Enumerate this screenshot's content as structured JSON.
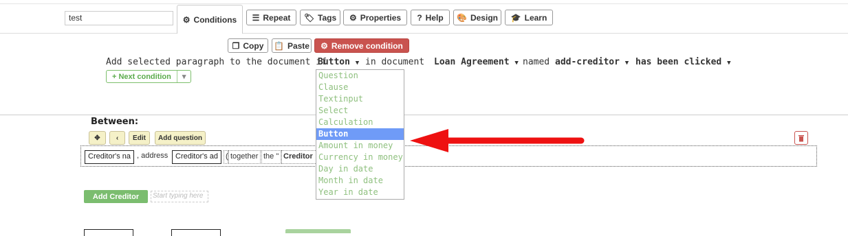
{
  "title_input_value": "test",
  "tabs": [
    {
      "label": "Conditions",
      "icon": "cogs-icon"
    },
    {
      "label": "Repeat",
      "icon": "list-ordered-icon"
    },
    {
      "label": "Tags",
      "icon": "tag-icon"
    },
    {
      "label": "Properties",
      "icon": "gear-icon"
    },
    {
      "label": "Help",
      "icon": "question-icon"
    },
    {
      "label": "Design",
      "icon": "palette-icon"
    },
    {
      "label": "Learn",
      "icon": "graduation-cap-icon"
    }
  ],
  "actions": {
    "copy": "Copy",
    "paste": "Paste",
    "remove": "Remove condition"
  },
  "condition": {
    "prefix": "Add selected paragraph to the document if",
    "type_value": "Button",
    "in_document": "in document",
    "document_value": "Loan Agreement",
    "named": "named",
    "name_value": "add-creditor",
    "event_value": "has been clicked",
    "next": "+ Next condition"
  },
  "dropdown_options": [
    "Question",
    "Clause",
    "Textinput",
    "Select",
    "Calculation",
    "Button",
    "Amount in money",
    "Currency in money",
    "Day in date",
    "Month in date",
    "Year in date"
  ],
  "dropdown_selected": "Button",
  "between": {
    "label": "Between:",
    "edit": "Edit",
    "add_question": "Add question"
  },
  "paragraph": {
    "field1": "Creditor's na",
    "text1": ", address",
    "field2": "Creditor's ad",
    "text2": "(",
    "text3": "together",
    "text4": "the \"",
    "field3": "Creditor"
  },
  "add_creditor": "Add Creditor",
  "typing_placeholder": "Start typing here",
  "colors": {
    "accent_red": "#c9534f",
    "green": "#7bbd6f",
    "selected_blue": "#6f9bf7",
    "arrow": "#ee1111"
  }
}
